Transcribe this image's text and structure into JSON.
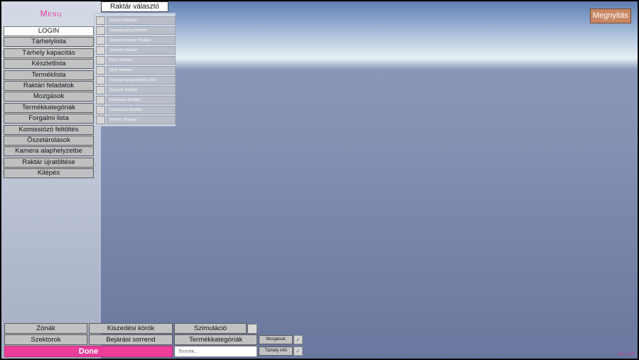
{
  "menu": {
    "title": "Menu",
    "items": [
      "LOGIN",
      "Tárhelylista",
      "Tárhely kapacitás",
      "Készletlista",
      "Terméklista",
      "Raktári feladatok",
      "Mozgások",
      "Termékkategóriák",
      "Forgalmi lista",
      "Komissiózó feltöltés",
      "Öszetárolások",
      "Kamera alaphelyzetbe",
      "Raktár újratöltése",
      "Kilépés"
    ]
  },
  "warehouse_selector": {
    "title": "Raktár választó",
    "items": [
      "Szeged főraktár",
      "Zalaegerszeg főraktár",
      "Székesfehérvár főraktár",
      "Veszélé főraktár",
      "Pécs főraktár",
      "Győr főraktár",
      "Zalaegerszeg főraktár (2E)",
      "Szolnok főraktár",
      "Debrecen főraktár",
      "Dunakeszi főraktár",
      "Miskolc főraktár"
    ]
  },
  "open_button": "Megnyitás",
  "bottom": {
    "zones": "Zónák",
    "pickup_rounds": "Kiszedési körök",
    "simulation": "Szimuláció",
    "sectors": "Szektorok",
    "walk_order": "Bejárási sorrend",
    "product_categories": "Termékkategóriák",
    "movements_small": "Mozgások",
    "storage_info_small": "Tárhely infó",
    "done": "Done",
    "product_placeholder": "Termék...",
    "check_mark": "✓"
  },
  "version": "ver 1.0.0"
}
